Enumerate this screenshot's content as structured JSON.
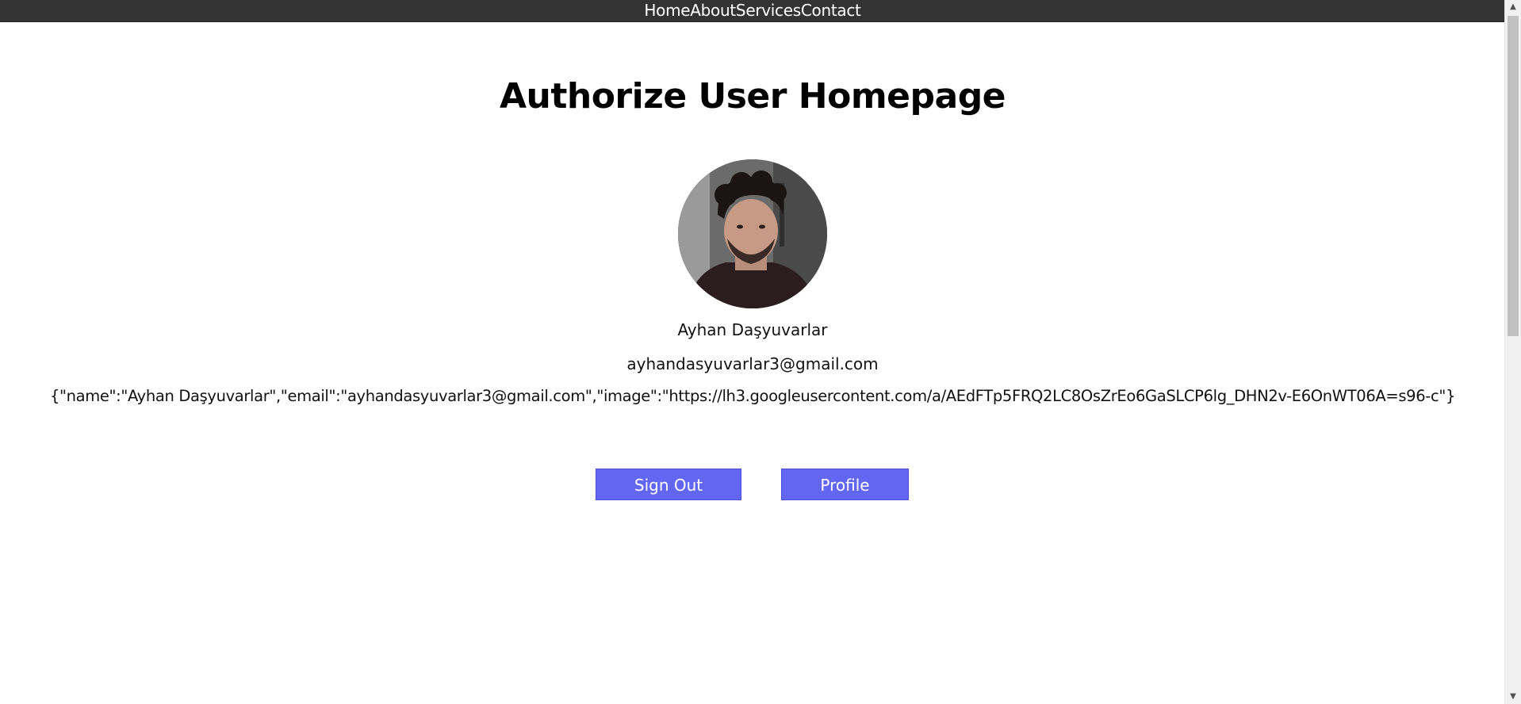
{
  "nav": {
    "items": [
      {
        "label": "Home"
      },
      {
        "label": "About"
      },
      {
        "label": "Services"
      },
      {
        "label": "Contact"
      }
    ]
  },
  "page": {
    "title": "Authorize User Homepage"
  },
  "user": {
    "name": "Ayhan Daşyuvarlar",
    "email": "ayhandasyuvarlar3@gmail.com",
    "json": "{\"name\":\"Ayhan Daşyuvarlar\",\"email\":\"ayhandasyuvarlar3@gmail.com\",\"image\":\"https://lh3.googleusercontent.com/a/AEdFTp5FRQ2LC8OsZrEo6GaSLCP6lg_DHN2v-E6OnWT06A=s96-c\"}"
  },
  "actions": {
    "sign_out_label": "Sign Out",
    "profile_label": "Profile"
  },
  "colors": {
    "navbar": "#333333",
    "button": "#6366f1"
  }
}
